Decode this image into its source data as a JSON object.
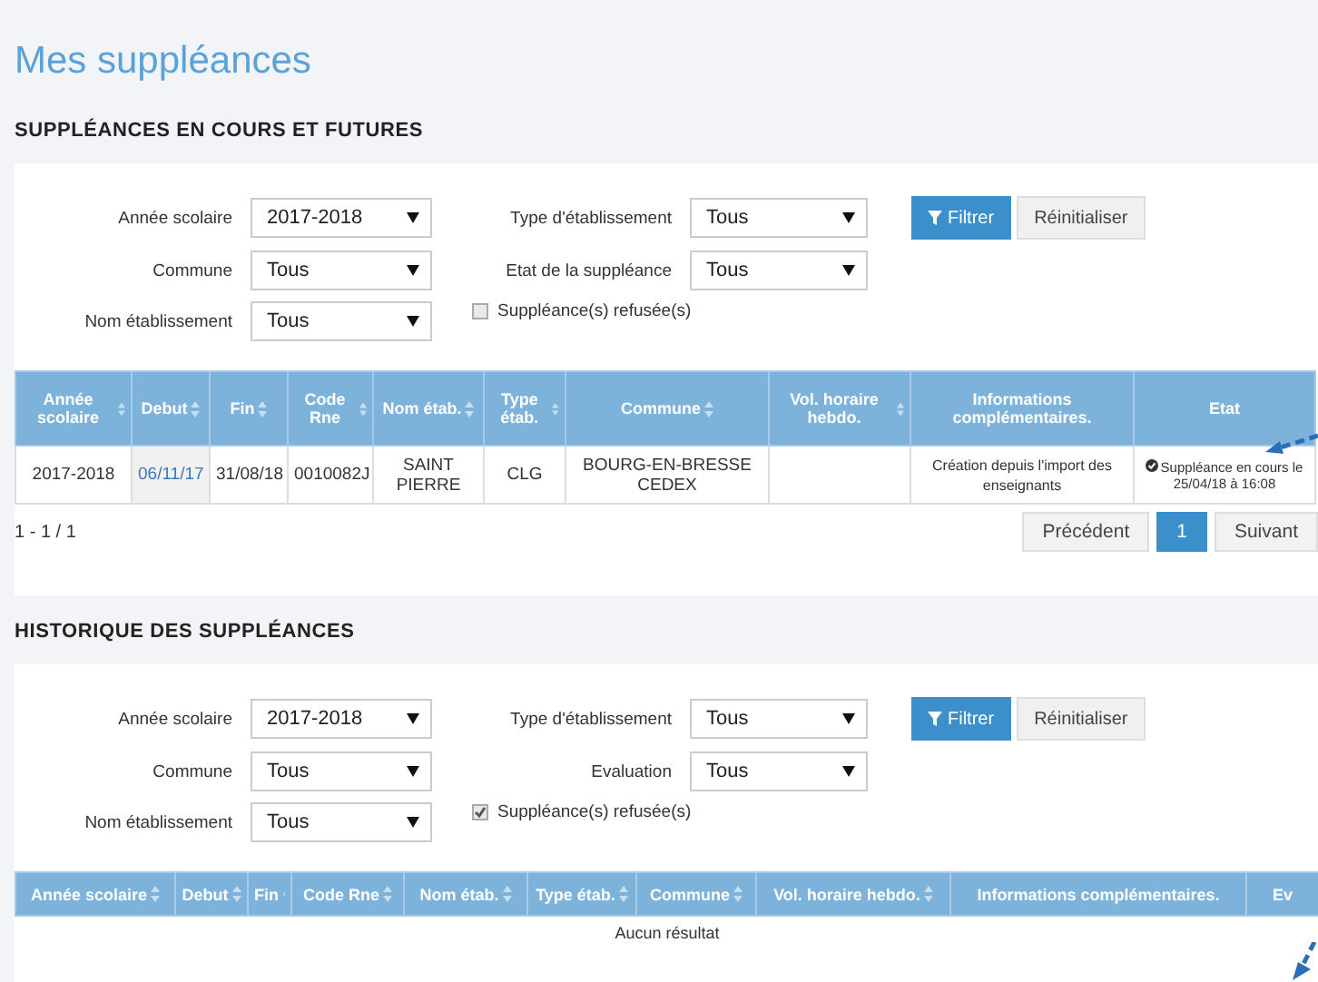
{
  "title": "Mes suppléances",
  "sections": [
    {
      "heading": "SUPPLÉANCES EN COURS ET FUTURES",
      "filters": [
        {
          "label": "Année scolaire",
          "value": "2017-2018"
        },
        {
          "label": "Type d'établissement",
          "value": "Tous"
        },
        {
          "label": "Commune",
          "value": "Tous"
        },
        {
          "label": "Etat de la suppléance",
          "value": "Tous"
        },
        {
          "label": "Nom établissement",
          "value": "Tous"
        }
      ],
      "checkbox": {
        "label": "Suppléance(s) refusée(s)",
        "checked": false
      },
      "buttons": {
        "filter": "Filtrer",
        "reset": "Réinitialiser"
      },
      "table": {
        "columns": [
          {
            "label": "Année scolaire",
            "sortable": true
          },
          {
            "label": "Debut",
            "sortable": true
          },
          {
            "label": "Fin",
            "sortable": true
          },
          {
            "label": "Code Rne",
            "sortable": true
          },
          {
            "label": "Nom étab.",
            "sortable": true
          },
          {
            "label": "Type étab.",
            "sortable": true
          },
          {
            "label": "Commune",
            "sortable": true
          },
          {
            "label": "Vol. horaire hebdo.",
            "sortable": true
          },
          {
            "label": "Informations complémentaires.",
            "sortable": false
          },
          {
            "label": "Etat",
            "sortable": false
          }
        ],
        "rows": [
          [
            {
              "kind": "text",
              "text": "2017-2018"
            },
            {
              "kind": "link",
              "text": "06/11/17"
            },
            {
              "kind": "text",
              "text": "31/08/18"
            },
            {
              "kind": "text",
              "text": "0010082J"
            },
            {
              "kind": "text",
              "text": "SAINT PIERRE"
            },
            {
              "kind": "text",
              "text": "CLG"
            },
            {
              "kind": "text",
              "text": "BOURG-EN-BRESSE CEDEX"
            },
            {
              "kind": "text",
              "text": ""
            },
            {
              "kind": "small",
              "text": "Création depuis l'import des enseignants"
            },
            {
              "kind": "status",
              "text": "Suppléance en cours le 25/04/18 à 16:08"
            }
          ]
        ]
      },
      "pagination": {
        "summary": "1 - 1 / 1",
        "previous": "Précédent",
        "next": "Suivant",
        "pages": [
          {
            "label": "1",
            "selected": true
          }
        ]
      }
    },
    {
      "heading": "HISTORIQUE DES SUPPLÉANCES",
      "filters": [
        {
          "label": "Année scolaire",
          "value": "2017-2018"
        },
        {
          "label": "Type d'établissement",
          "value": "Tous"
        },
        {
          "label": "Commune",
          "value": "Tous"
        },
        {
          "label": "Evaluation",
          "value": "Tous"
        },
        {
          "label": "Nom établissement",
          "value": "Tous"
        }
      ],
      "checkbox": {
        "label": "Suppléance(s) refusée(s)",
        "checked": true
      },
      "buttons": {
        "filter": "Filtrer",
        "reset": "Réinitialiser"
      },
      "table": {
        "columns": [
          {
            "label": "Année scolaire",
            "sortable": true
          },
          {
            "label": "Debut",
            "sortable": true
          },
          {
            "label": "Fin",
            "sortable": true
          },
          {
            "label": "Code Rne",
            "sortable": true
          },
          {
            "label": "Nom étab.",
            "sortable": true
          },
          {
            "label": "Type étab.",
            "sortable": true
          },
          {
            "label": "Commune",
            "sortable": true
          },
          {
            "label": "Vol. horaire hebdo.",
            "sortable": true
          },
          {
            "label": "Informations complémentaires.",
            "sortable": false
          },
          {
            "label": "Ev",
            "sortable": false
          }
        ],
        "empty_text": "Aucun résultat"
      }
    }
  ]
}
